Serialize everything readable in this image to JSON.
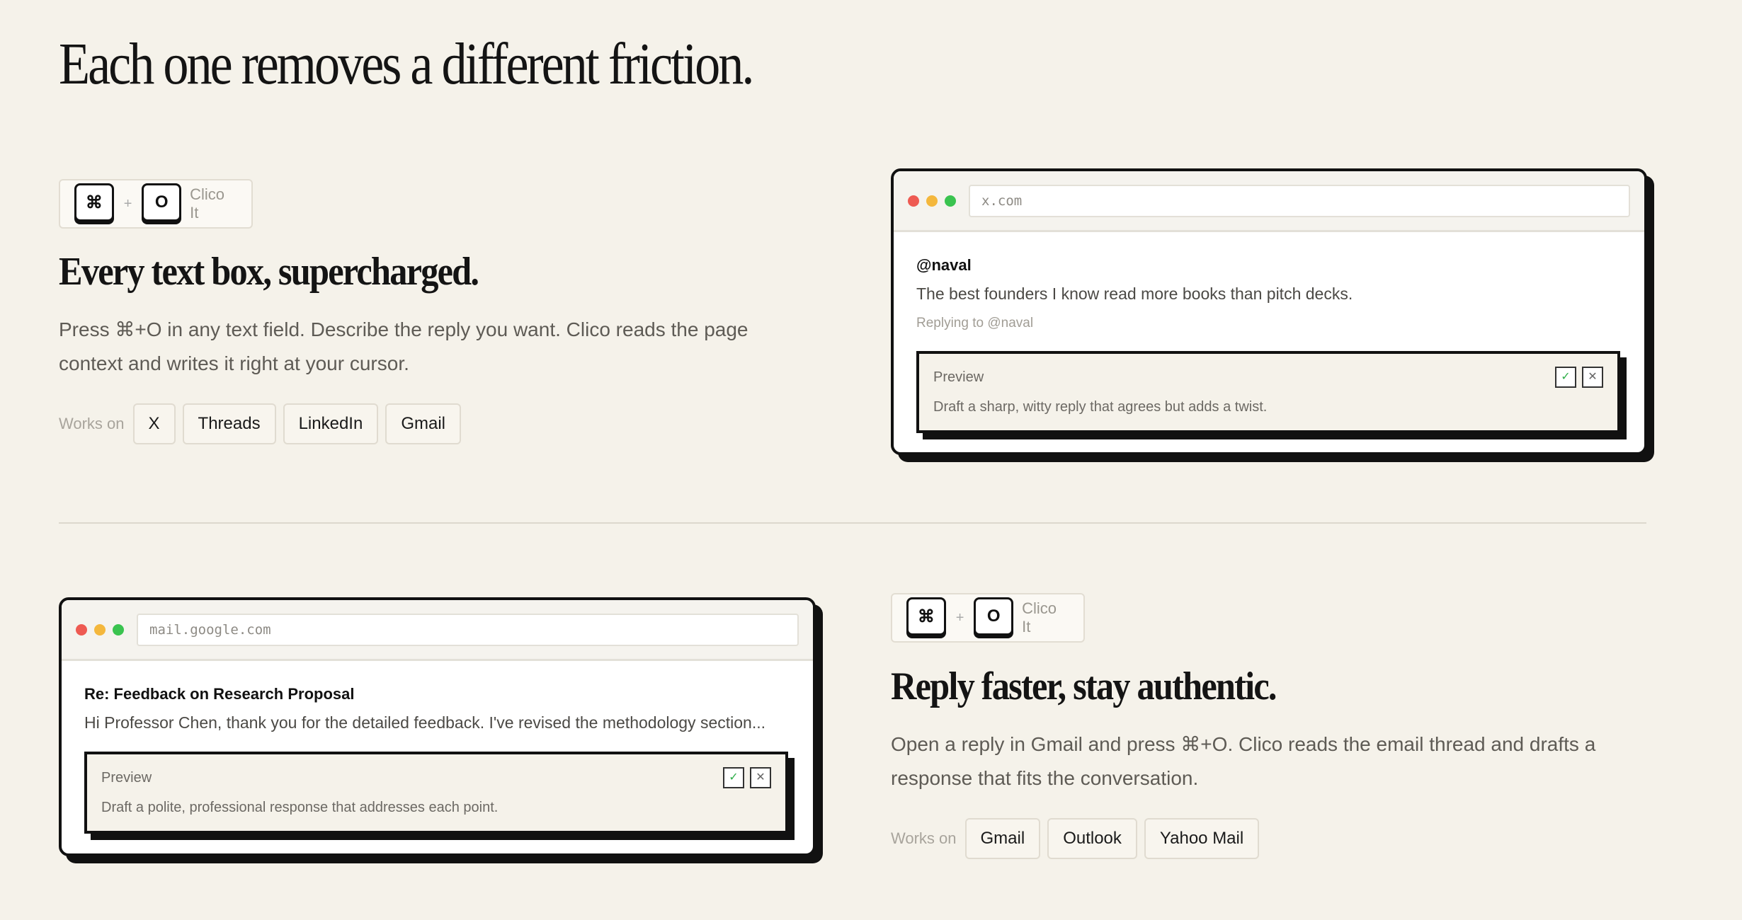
{
  "page": {
    "title": "Each one removes a different friction."
  },
  "feature1": {
    "shortcut": {
      "key1": "⌘",
      "plus": "+",
      "key2": "O",
      "label": "Clico It"
    },
    "title": "Every text box, supercharged.",
    "desc_line1": "Press ⌘+O in any text field. Describe the reply you want. Clico reads the page",
    "desc_line2": "context and writes it right at your cursor.",
    "works_label": "Works on",
    "platforms": [
      "X",
      "Threads",
      "LinkedIn",
      "Gmail"
    ],
    "browser": {
      "url": "x.com",
      "handle": "@naval",
      "tweet": "The best founders I know read more books than pitch decks.",
      "replying": "Replying to @naval",
      "preview_label": "Preview",
      "preview_text": "Draft a sharp, witty reply that agrees but adds a twist.",
      "accept_icon": "✓",
      "reject_icon": "✕"
    }
  },
  "feature2": {
    "shortcut": {
      "key1": "⌘",
      "plus": "+",
      "key2": "O",
      "label": "Clico It"
    },
    "title": "Reply faster, stay authentic.",
    "desc_line1": "Open a reply in Gmail and press ⌘+O. Clico reads the email thread and drafts a",
    "desc_line2": "response that fits the conversation.",
    "works_label": "Works on",
    "platforms": [
      "Gmail",
      "Outlook",
      "Yahoo Mail"
    ],
    "browser": {
      "url": "mail.google.com",
      "subject": "Re: Feedback on Research Proposal",
      "body": "Hi Professor Chen, thank you for the detailed feedback. I've revised the methodology section...",
      "preview_label": "Preview",
      "preview_text": "Draft a polite, professional response that addresses each point.",
      "accept_icon": "✓",
      "reject_icon": "✕"
    }
  },
  "colors": {
    "background": "#f5f2ea",
    "dot_red": "#ee5a52",
    "dot_yellow": "#f4b73c",
    "dot_green": "#3ac34f",
    "accept_green": "#2fae4a"
  }
}
